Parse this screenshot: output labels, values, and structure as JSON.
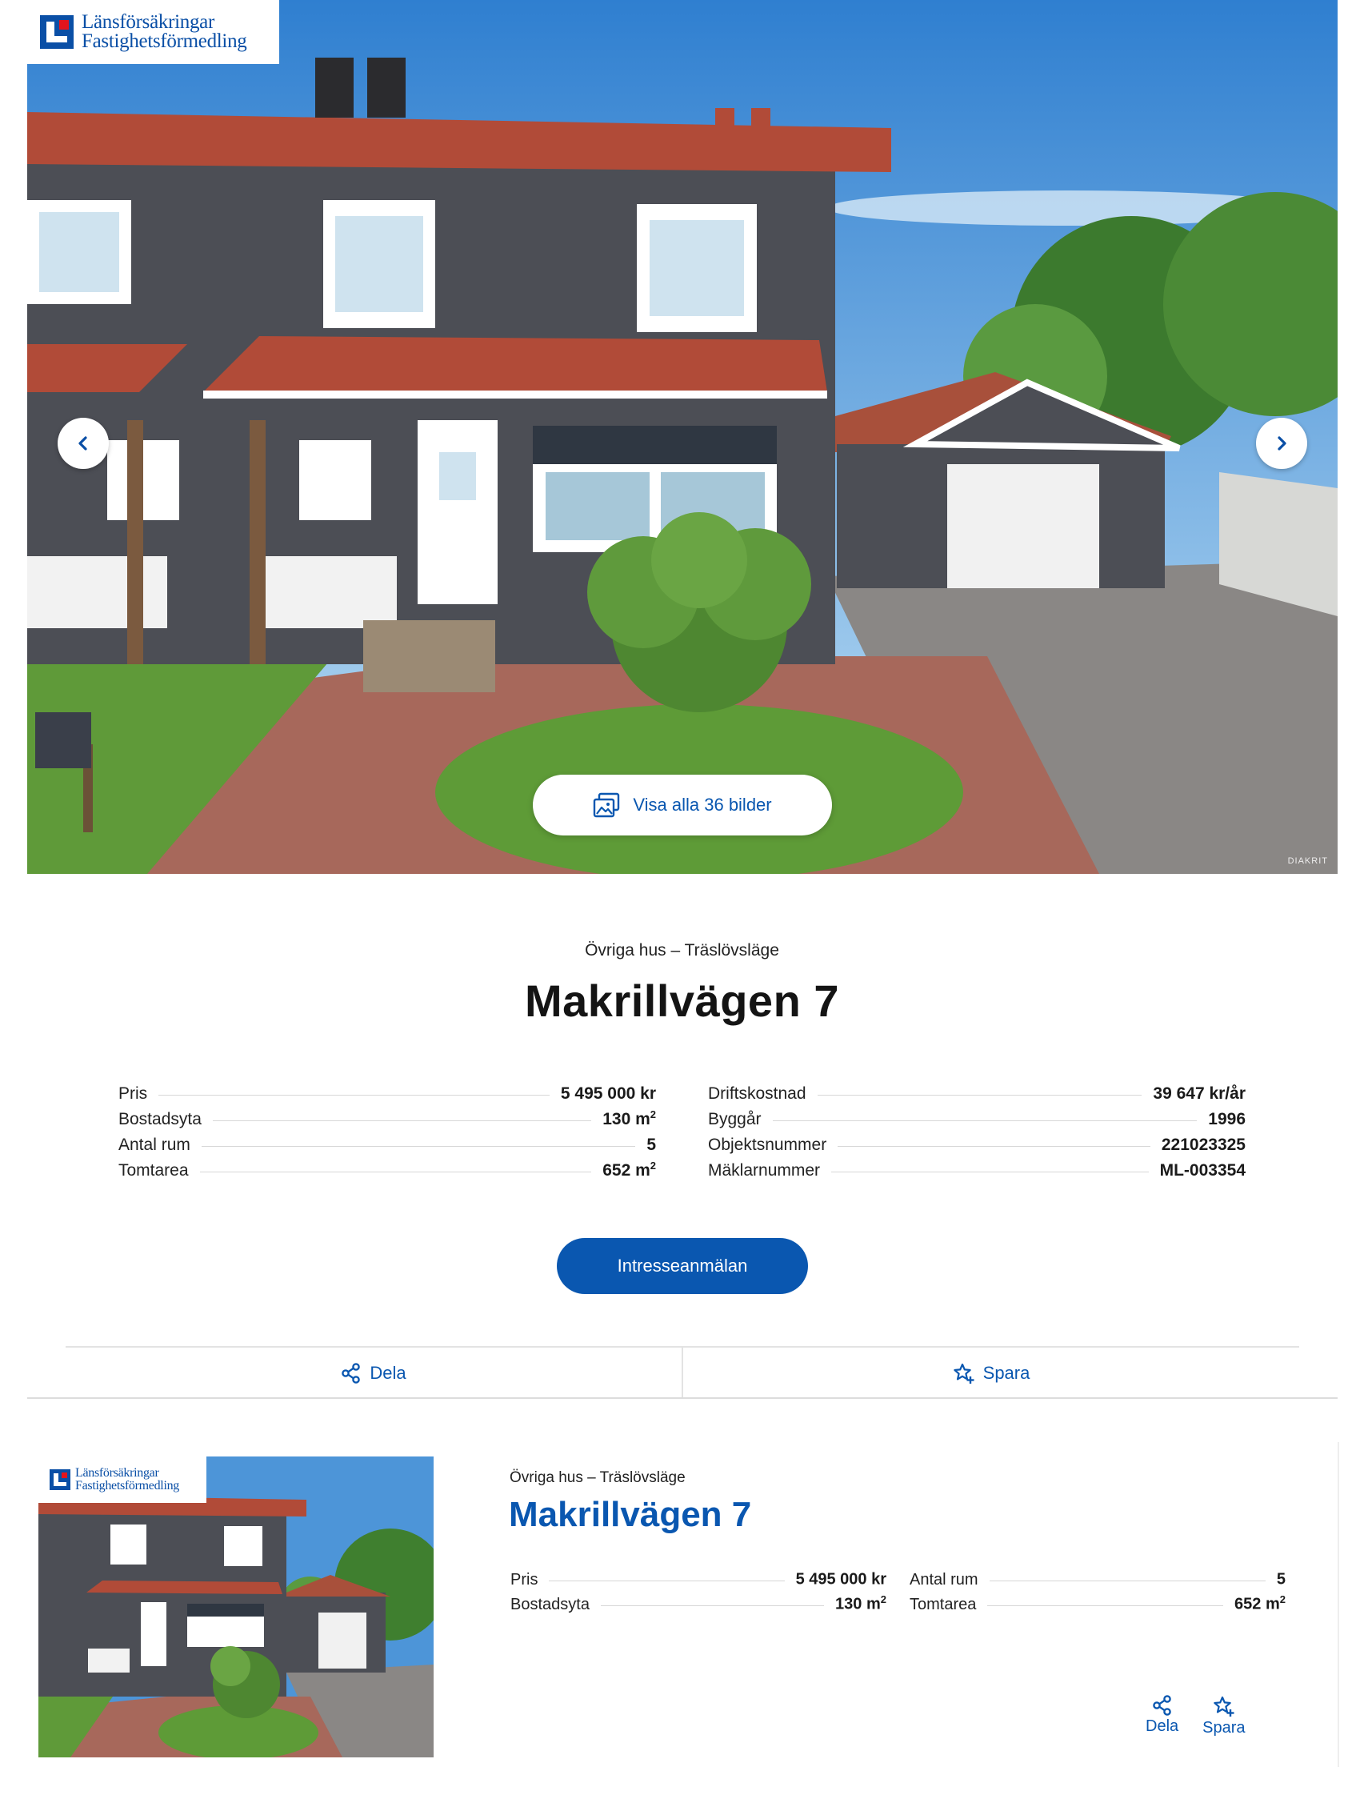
{
  "brand": {
    "logo_line1": "Länsförsäkringar",
    "logo_line2": "Fastighetsförmedling"
  },
  "gallery": {
    "show_all_label": "Visa alla 36 bilder",
    "photo_credit": "DIAKRIT",
    "prev_icon": "chevron-left-icon",
    "next_icon": "chevron-right-icon"
  },
  "listing": {
    "category": "Övriga hus – Träslövsläge",
    "title": "Makrillvägen 7",
    "facts_left": [
      {
        "label": "Pris",
        "value": "5 495 000 kr",
        "sup": ""
      },
      {
        "label": "Bostadsyta",
        "value": "130 m",
        "sup": "2"
      },
      {
        "label": "Antal rum",
        "value": "5",
        "sup": ""
      },
      {
        "label": "Tomtarea",
        "value": "652 m",
        "sup": "2"
      }
    ],
    "facts_right": [
      {
        "label": "Driftskostnad",
        "value": "39 647 kr/år",
        "sup": ""
      },
      {
        "label": "Byggår",
        "value": "1996",
        "sup": ""
      },
      {
        "label": "Objektsnummer",
        "value": "221023325",
        "sup": ""
      },
      {
        "label": "Mäklarnummer",
        "value": "ML-003354",
        "sup": ""
      }
    ],
    "cta_label": "Intresseanmälan",
    "share_label": "Dela",
    "save_label": "Spara"
  },
  "card": {
    "category": "Övriga hus – Träslövsläge",
    "title": "Makrillvägen 7",
    "facts_left": [
      {
        "label": "Pris",
        "value": "5 495 000 kr",
        "sup": ""
      },
      {
        "label": "Bostadsyta",
        "value": "130 m",
        "sup": "2"
      }
    ],
    "facts_right": [
      {
        "label": "Antal rum",
        "value": "5",
        "sup": ""
      },
      {
        "label": "Tomtarea",
        "value": "652 m",
        "sup": "2"
      }
    ],
    "share_label": "Dela",
    "save_label": "Spara"
  },
  "colors": {
    "brand_blue": "#0a57b0",
    "logo_red": "#e3141d"
  }
}
